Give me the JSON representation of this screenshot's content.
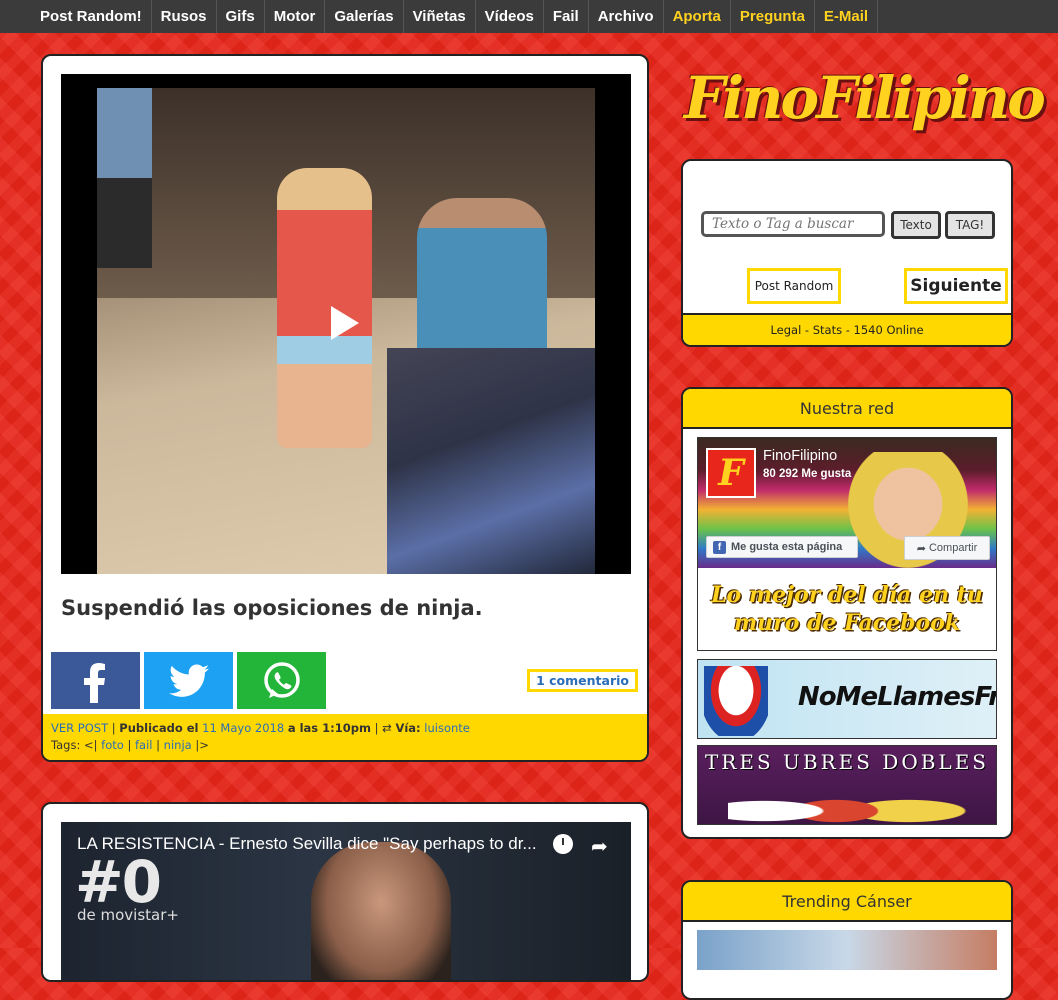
{
  "nav": {
    "items": [
      {
        "label": "Post Random!",
        "gold": false
      },
      {
        "label": "Rusos",
        "gold": false
      },
      {
        "label": "Gifs",
        "gold": false
      },
      {
        "label": "Motor",
        "gold": false
      },
      {
        "label": "Galerías",
        "gold": false
      },
      {
        "label": "Viñetas",
        "gold": false
      },
      {
        "label": "Vídeos",
        "gold": false
      },
      {
        "label": "Fail",
        "gold": false
      },
      {
        "label": "Archivo",
        "gold": false
      },
      {
        "label": "Aporta",
        "gold": true
      },
      {
        "label": "Pregunta",
        "gold": true
      },
      {
        "label": "E-Mail",
        "gold": true
      }
    ]
  },
  "site": {
    "logo": "FinoFilipino"
  },
  "post1": {
    "title": "Suspendió las oposiciones de ninja.",
    "comments": "1 comentario",
    "meta": {
      "ver_post": "VER POST",
      "published": "Publicado el",
      "date": "11 Mayo 2018",
      "time": "a las 1:10pm",
      "via_label": "Vía:",
      "via_user": "luisonte",
      "tags_label": "Tags: <|",
      "tags": [
        "foto",
        "fail",
        "ninja"
      ],
      "tags_end": "|>"
    }
  },
  "post2": {
    "video_title": "LA RESISTENCIA - Ernesto Sevilla dice \"Say perhaps to dr...",
    "logo_big": "#0",
    "logo_small": "de movistar+"
  },
  "search": {
    "placeholder": "Texto o Tag a buscar",
    "btn_texto": "Texto",
    "btn_tag": "TAG!",
    "btn_random": "Post Random",
    "btn_next": "Siguiente",
    "footer": "Legal - Stats - 1540 Online"
  },
  "red": {
    "header": "Nuestra red",
    "fb_name": "FinoFilipino",
    "fb_likes": "80 292 Me gusta",
    "fb_like_btn": "Me gusta esta página",
    "fb_share_btn": "Compartir",
    "fb_logo_letter": "F",
    "fb_tagline": "Lo mejor del día en tu muro de Facebook",
    "banner_friki": "NoMeLlamesFriki",
    "banner_tres": "TRES UBRES DOBLES"
  },
  "trend": {
    "header": "Trending Cánser"
  },
  "colors": {
    "background": "#e8261b",
    "accent": "#ffd800",
    "nav": "#3b3b3b",
    "link": "#2a6db8"
  }
}
